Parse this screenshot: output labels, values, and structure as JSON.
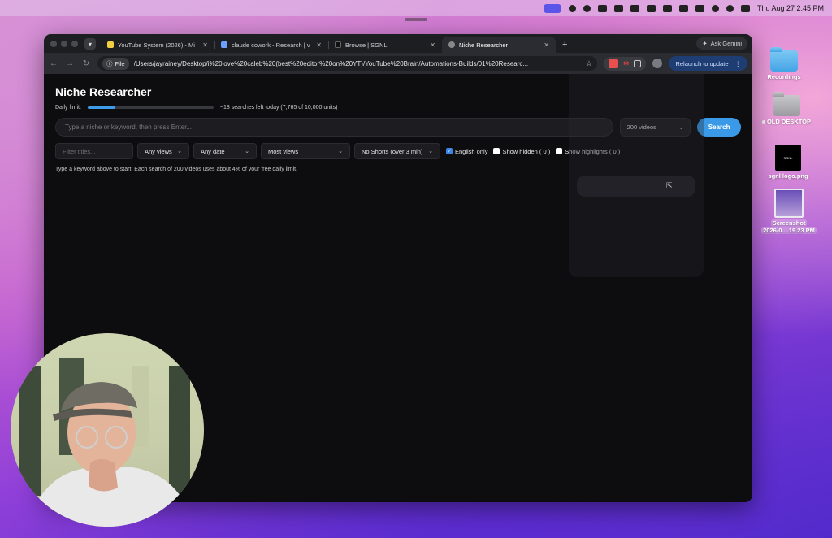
{
  "menubar": {
    "datetime": "Thu Aug 27  2:45 PM"
  },
  "tabs": [
    {
      "title": "YouTube System (2026) - Mi",
      "favicon_color": "#f0d040",
      "active": false
    },
    {
      "title": "claude cowork - Research | v",
      "favicon_color": "#6ca0ff",
      "active": false
    },
    {
      "title": "Browse | SGNL",
      "favicon_color": "#111111",
      "active": false
    },
    {
      "title": "Niche Researcher",
      "favicon_color": "#888888",
      "active": true
    }
  ],
  "browser": {
    "ask_gemini": "Ask Gemini",
    "file_chip": "File",
    "url": "/Users/jayrainey/Desktop/i%20love%20caleb%20(best%20editor%20on%20YT)/YouTube%20Brain/Automations-Builds/01%20Researc...",
    "relaunch": "Relaunch to update"
  },
  "app": {
    "title": "Niche Researcher",
    "daily_limit_label": "Daily limit:",
    "daily_limit_fraction": 0.22,
    "daily_limit_text": "~18 searches left today (7,765 of 10,000 units)",
    "search_placeholder": "Type a niche or keyword, then press Enter...",
    "count_select": "200 videos",
    "search_button": "Search",
    "filter_placeholder": "Filter titles...",
    "views_select": "Any views",
    "date_select": "Any date",
    "sort_select": "Most views",
    "shorts_select": "No Shorts (over 3 min)",
    "english_only": "English only",
    "english_only_checked": true,
    "show_hidden": "Show hidden ( 0 )",
    "show_highlights": "Show highlights ( 0 )",
    "hint": "Type a keyword above to start. Each search of 200 videos uses about 4% of your free daily limit."
  },
  "desktop": {
    "recordings": "Recordings",
    "old_desktop": "OLD DESKTOP",
    "sgnl_logo": "sgnl logo.png",
    "sgnl_thumb_text": "SGNL",
    "screenshot_line1": "Screenshot",
    "screenshot_line2": "2026-0....19.23 PM"
  },
  "colors": {
    "accent": "#3a9ae8",
    "window_bg": "#0d0c0e",
    "relaunch_bg": "#1d3d73"
  }
}
